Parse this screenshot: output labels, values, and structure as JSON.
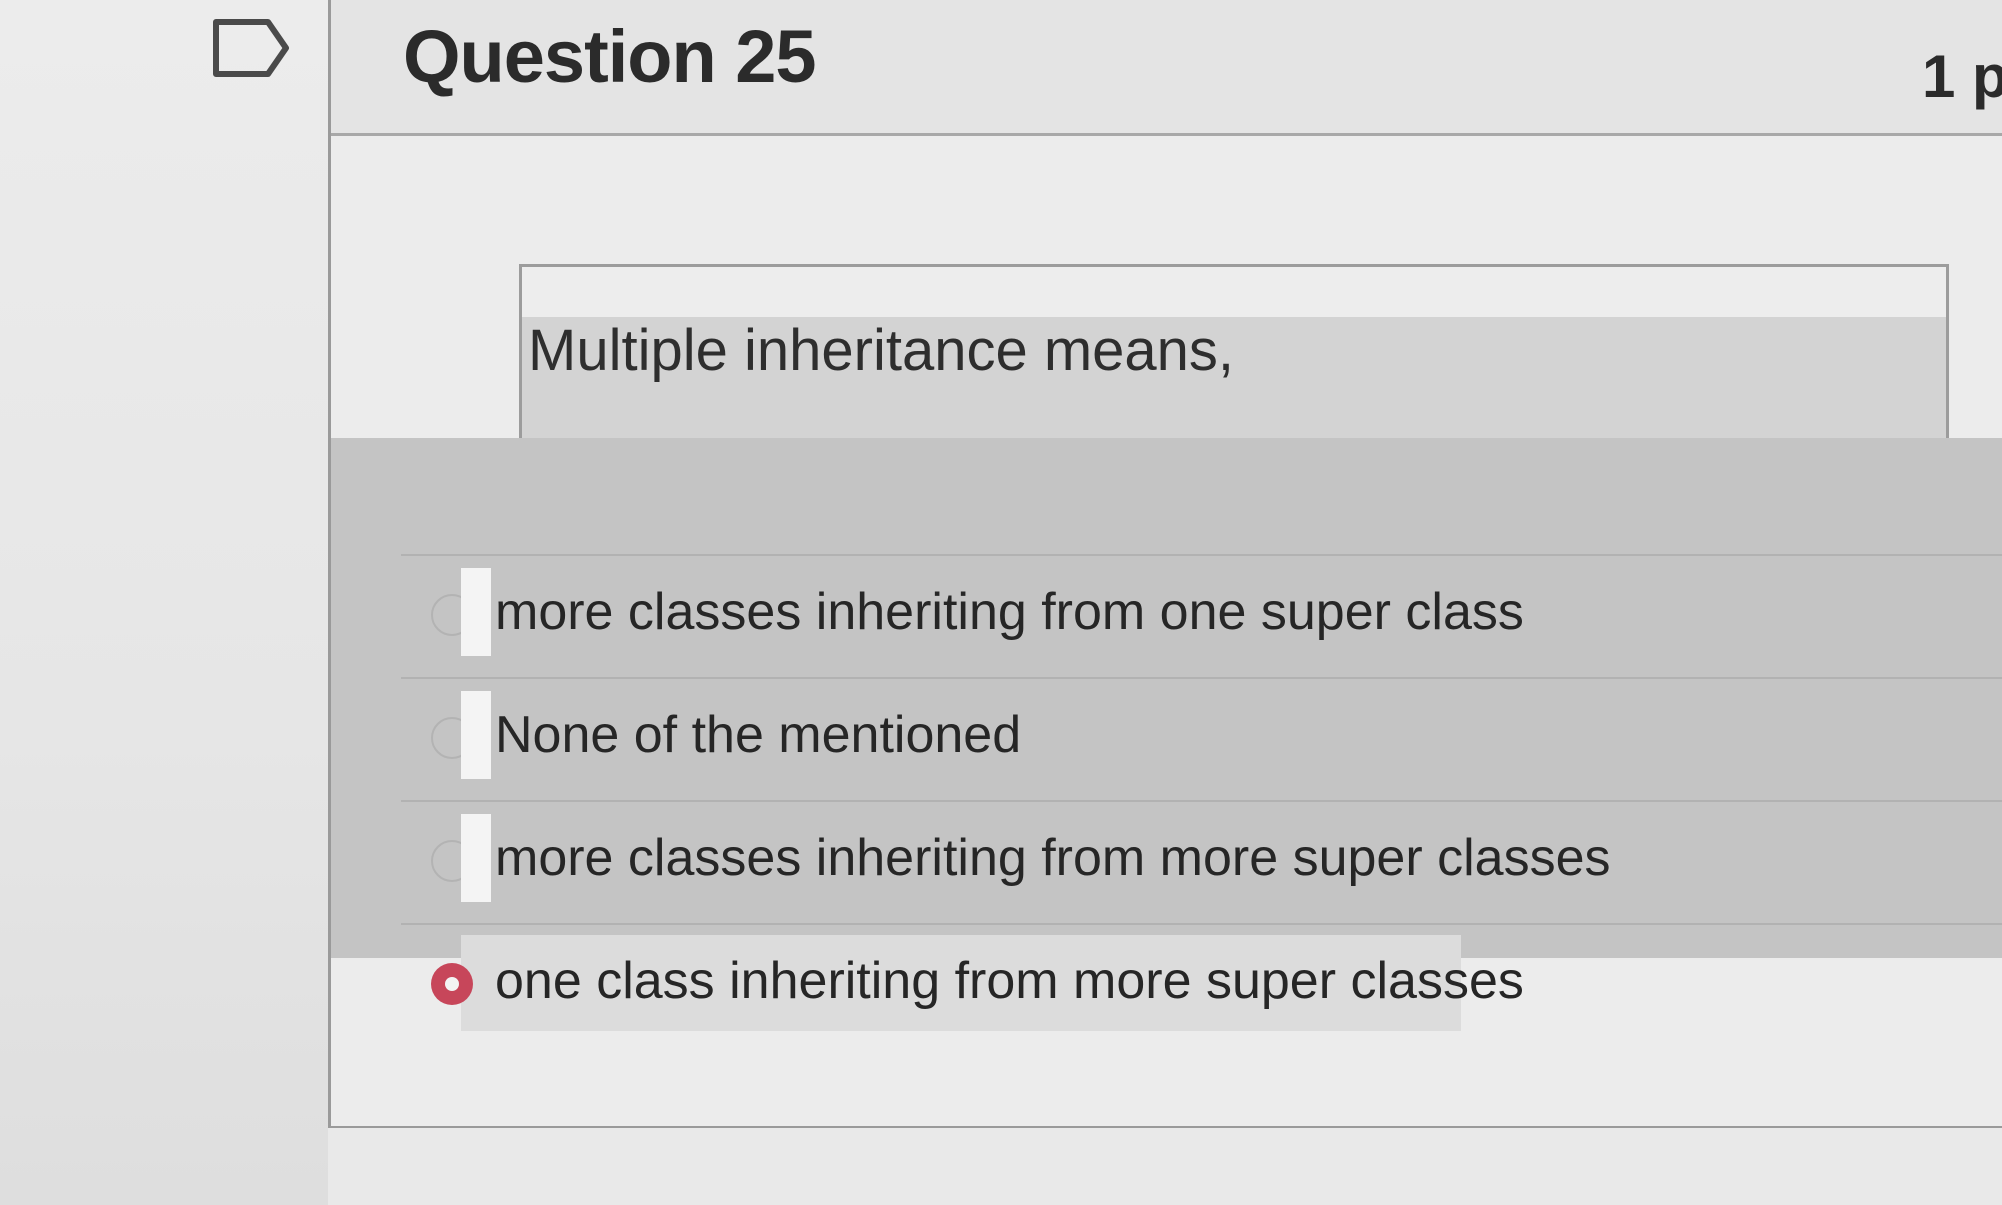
{
  "question": {
    "title": "Question 25",
    "points": "1 p",
    "prompt": "Multiple inheritance means,"
  },
  "answers": [
    {
      "label": "more classes inheriting from one super class",
      "selected": false
    },
    {
      "label": "None of the mentioned",
      "selected": false
    },
    {
      "label": "more classes inheriting from more super classes",
      "selected": false
    },
    {
      "label": "one class inheriting from more super classes",
      "selected": true
    }
  ],
  "icons": {
    "flag": "flag-outline-icon",
    "radio": "radio-button-icon"
  },
  "colors": {
    "selected_radio": "#c7465a",
    "answer_band": "#c4c4c4",
    "page_background": "#e9e9e9"
  }
}
